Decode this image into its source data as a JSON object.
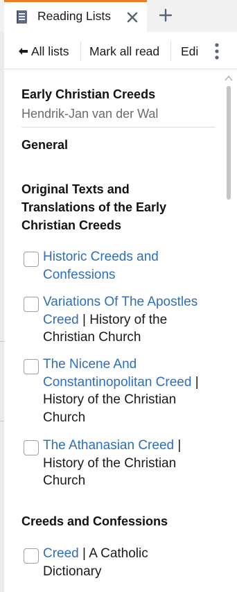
{
  "tab": {
    "title": "Reading Lists",
    "icon": "document-list-icon",
    "accent_color": "#f07a1d"
  },
  "toolbar": {
    "all_lists": "All lists",
    "mark_all_read": "Mark all read",
    "edit": "Edi"
  },
  "list": {
    "title": "Early Christian Creeds",
    "author": "Hendrik-Jan van der Wal"
  },
  "sections": [
    {
      "title": "General"
    },
    {
      "title_lines": [
        "Original Texts and",
        "Translations of the Early",
        "Christian Creeds"
      ],
      "items": [
        {
          "line1_link": "Historic Creeds and",
          "line2_link": "Confessions"
        },
        {
          "line1_link": "Variations Of The Apostles",
          "line2_link": "Creed",
          "line2_rest": " | History of the",
          "line3": "Christian Church"
        },
        {
          "line1_link": "The Nicene And",
          "line2_link": "Constantinopolitan Creed",
          "line2_rest": " |",
          "line3": "History of the Christian",
          "line4": "Church"
        },
        {
          "line1_link": "The Athanasian Creed",
          "line1_rest": " |",
          "line2": "History of the Christian",
          "line3": "Church"
        }
      ]
    },
    {
      "title": "Creeds and Confessions",
      "items": [
        {
          "line1_link": "Creed",
          "line1_rest": " | A Catholic",
          "line2": "Dictionary"
        }
      ]
    }
  ],
  "colors": {
    "link": "#2d6ebd",
    "checkbox_border": "#9e9e9e"
  }
}
